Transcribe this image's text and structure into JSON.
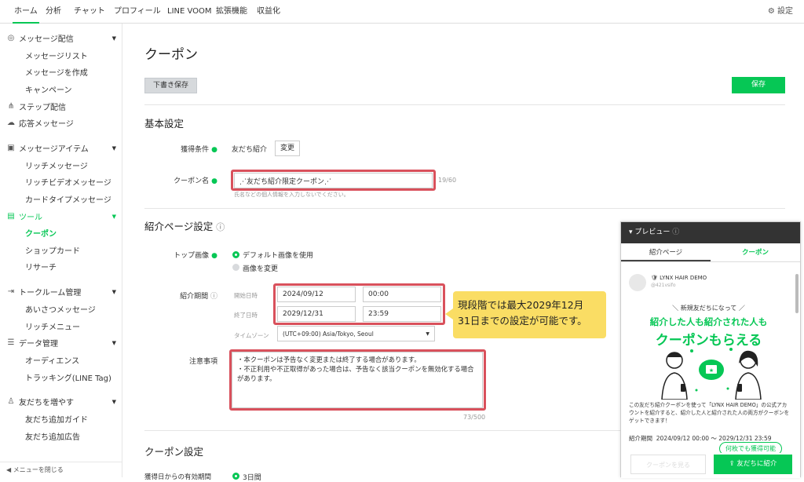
{
  "topnav": {
    "tabs": [
      "ホーム",
      "分析",
      "チャット",
      "プロフィール",
      "LINE VOOM",
      "拡張機能",
      "収益化"
    ],
    "settings": "設定"
  },
  "sidebar": {
    "groups": [
      {
        "label": "メッセージ配信",
        "icon": "broadcast-icon",
        "items": [
          "メッセージリスト",
          "メッセージを作成",
          "キャンペーン"
        ]
      },
      {
        "label": "ステップ配信",
        "icon": "step-icon",
        "items": []
      },
      {
        "label": "応答メッセージ",
        "icon": "chat-icon",
        "items": []
      },
      {
        "label": "メッセージアイテム",
        "icon": "message-item-icon",
        "items": [
          "リッチメッセージ",
          "リッチビデオメッセージ",
          "カードタイプメッセージ"
        ]
      },
      {
        "label": "ツール",
        "icon": "tool-icon",
        "items": [
          "クーポン",
          "ショップカード",
          "リサーチ"
        ]
      },
      {
        "label": "トークルーム管理",
        "icon": "talkroom-icon",
        "items": [
          "あいさつメッセージ",
          "リッチメニュー"
        ]
      },
      {
        "label": "データ管理",
        "icon": "database-icon",
        "items": [
          "オーディエンス",
          "トラッキング(LINE Tag)"
        ]
      },
      {
        "label": "友だちを増やす",
        "icon": "add-friend-icon",
        "items": [
          "友だち追加ガイド",
          "友だち追加広告"
        ]
      }
    ],
    "collapse": "メニューを閉じる"
  },
  "page": {
    "title": "クーポン",
    "draft_button": "下書き保存",
    "save_button": "保存"
  },
  "basic": {
    "heading": "基本設定",
    "condition_label": "獲得条件",
    "condition_value": "友だち紹介",
    "change_button": "変更",
    "name_label": "クーポン名",
    "name_value": "⋰友だち紹介限定クーポン⋰",
    "name_count": "19/60",
    "name_hint": "氏名などの個人情報を入力しないでください。"
  },
  "intro": {
    "heading": "紹介ページ設定",
    "top_image_label": "トップ画像",
    "opt_default": "デフォルト画像を使用",
    "opt_change": "画像を変更",
    "period_label": "紹介期間",
    "start_label": "開始日時",
    "start_date": "2024/09/12",
    "start_time": "00:00",
    "end_label": "終了日時",
    "end_date": "2029/12/31",
    "end_time": "23:59",
    "tz_label": "タイムゾーン",
    "tz_value": "(UTC+09:00) Asia/Tokyo, Seoul",
    "notes_label": "注意事項",
    "notes_line1": "・本クーポンは予告なく変更または終了する場合があります。",
    "notes_line2": "・不正利用や不正取得があった場合は、予告なく該当クーポンを無効化する場合",
    "notes_line3": "があります。",
    "notes_count": "73/500"
  },
  "callout": {
    "line1": "現段階では最大2029年12月",
    "line2": "31日までの設定が可能です。"
  },
  "coupon": {
    "heading": "クーポン設定",
    "validity_label": "獲得日からの有効期間",
    "validity_value": "3日間"
  },
  "preview": {
    "header": "プレビュー",
    "tab_intro": "紹介ページ",
    "tab_coupon": "クーポン",
    "account": "LYNX HAIR DEMO",
    "account_id": "@421vsifo",
    "banner_line1": "＼ 新規友だちになって ／",
    "banner_line2": "紹介した人も紹介された人も",
    "banner_line3": "クーポンもらえる",
    "desc": "この友だち紹介クーポンを使って「LYNX HAIR DEMO」の公式アカウントを紹介すると、紹介した人と紹介された人の両方がクーポンをゲットできます！",
    "period_label": "紹介期間",
    "period_value": "2024/09/12 00:00 〜 2029/12/31 23:59",
    "pill": "何枚でも獲得可能",
    "view_coupon": "クーポンを見る",
    "share_button": "友だちに紹介"
  },
  "colors": {
    "accent": "#06c755",
    "highlight": "#d9515c",
    "callout": "#fadd64"
  }
}
